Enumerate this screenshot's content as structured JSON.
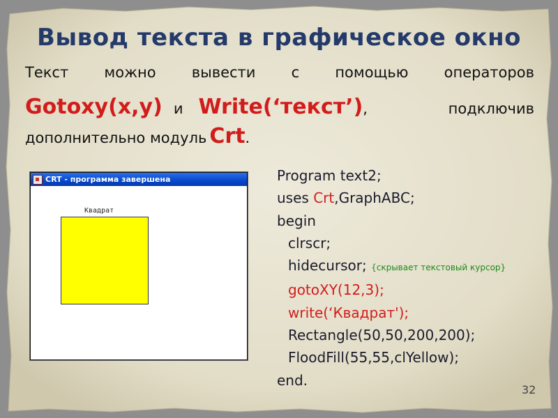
{
  "title": "Вывод текста в графическое окно",
  "paragraph": {
    "line1": [
      "Текст",
      "можно",
      "вывести",
      "с",
      "помощью",
      "операторов"
    ],
    "gotoxy": "Gotoxy(x,y)",
    "and_word": "и",
    "write": "Write(‘текст’)",
    "comma": ",",
    "connecting": "подключив",
    "line3_text": "дополнительно модуль",
    "crt": "Crt",
    "period": "."
  },
  "window": {
    "title": "CRT - программа завершена",
    "label": "Квадрат",
    "fill_color": "#ffff00"
  },
  "code": {
    "line1": "Program text2;",
    "uses_kw": "uses ",
    "uses_crt": "Crt",
    "uses_rest": ",GraphABC;",
    "begin": "begin",
    "clrscr": "clrscr;",
    "hidecursor": "hidecursor;",
    "comment": "{скрывает текстовый курсор}",
    "gotoxy": "gotoXY(12,3);",
    "write": "write(‘Квадрат');",
    "rectangle": "Rectangle(50,50,200,200);",
    "floodfill": "FloodFill(55,55,clYellow);",
    "end": "end."
  },
  "page_number": "32",
  "colors": {
    "title": "#243a6a",
    "accent_red": "#d21c1c",
    "comment_green": "#1b8a1b",
    "paper": "#e6e2cf"
  }
}
